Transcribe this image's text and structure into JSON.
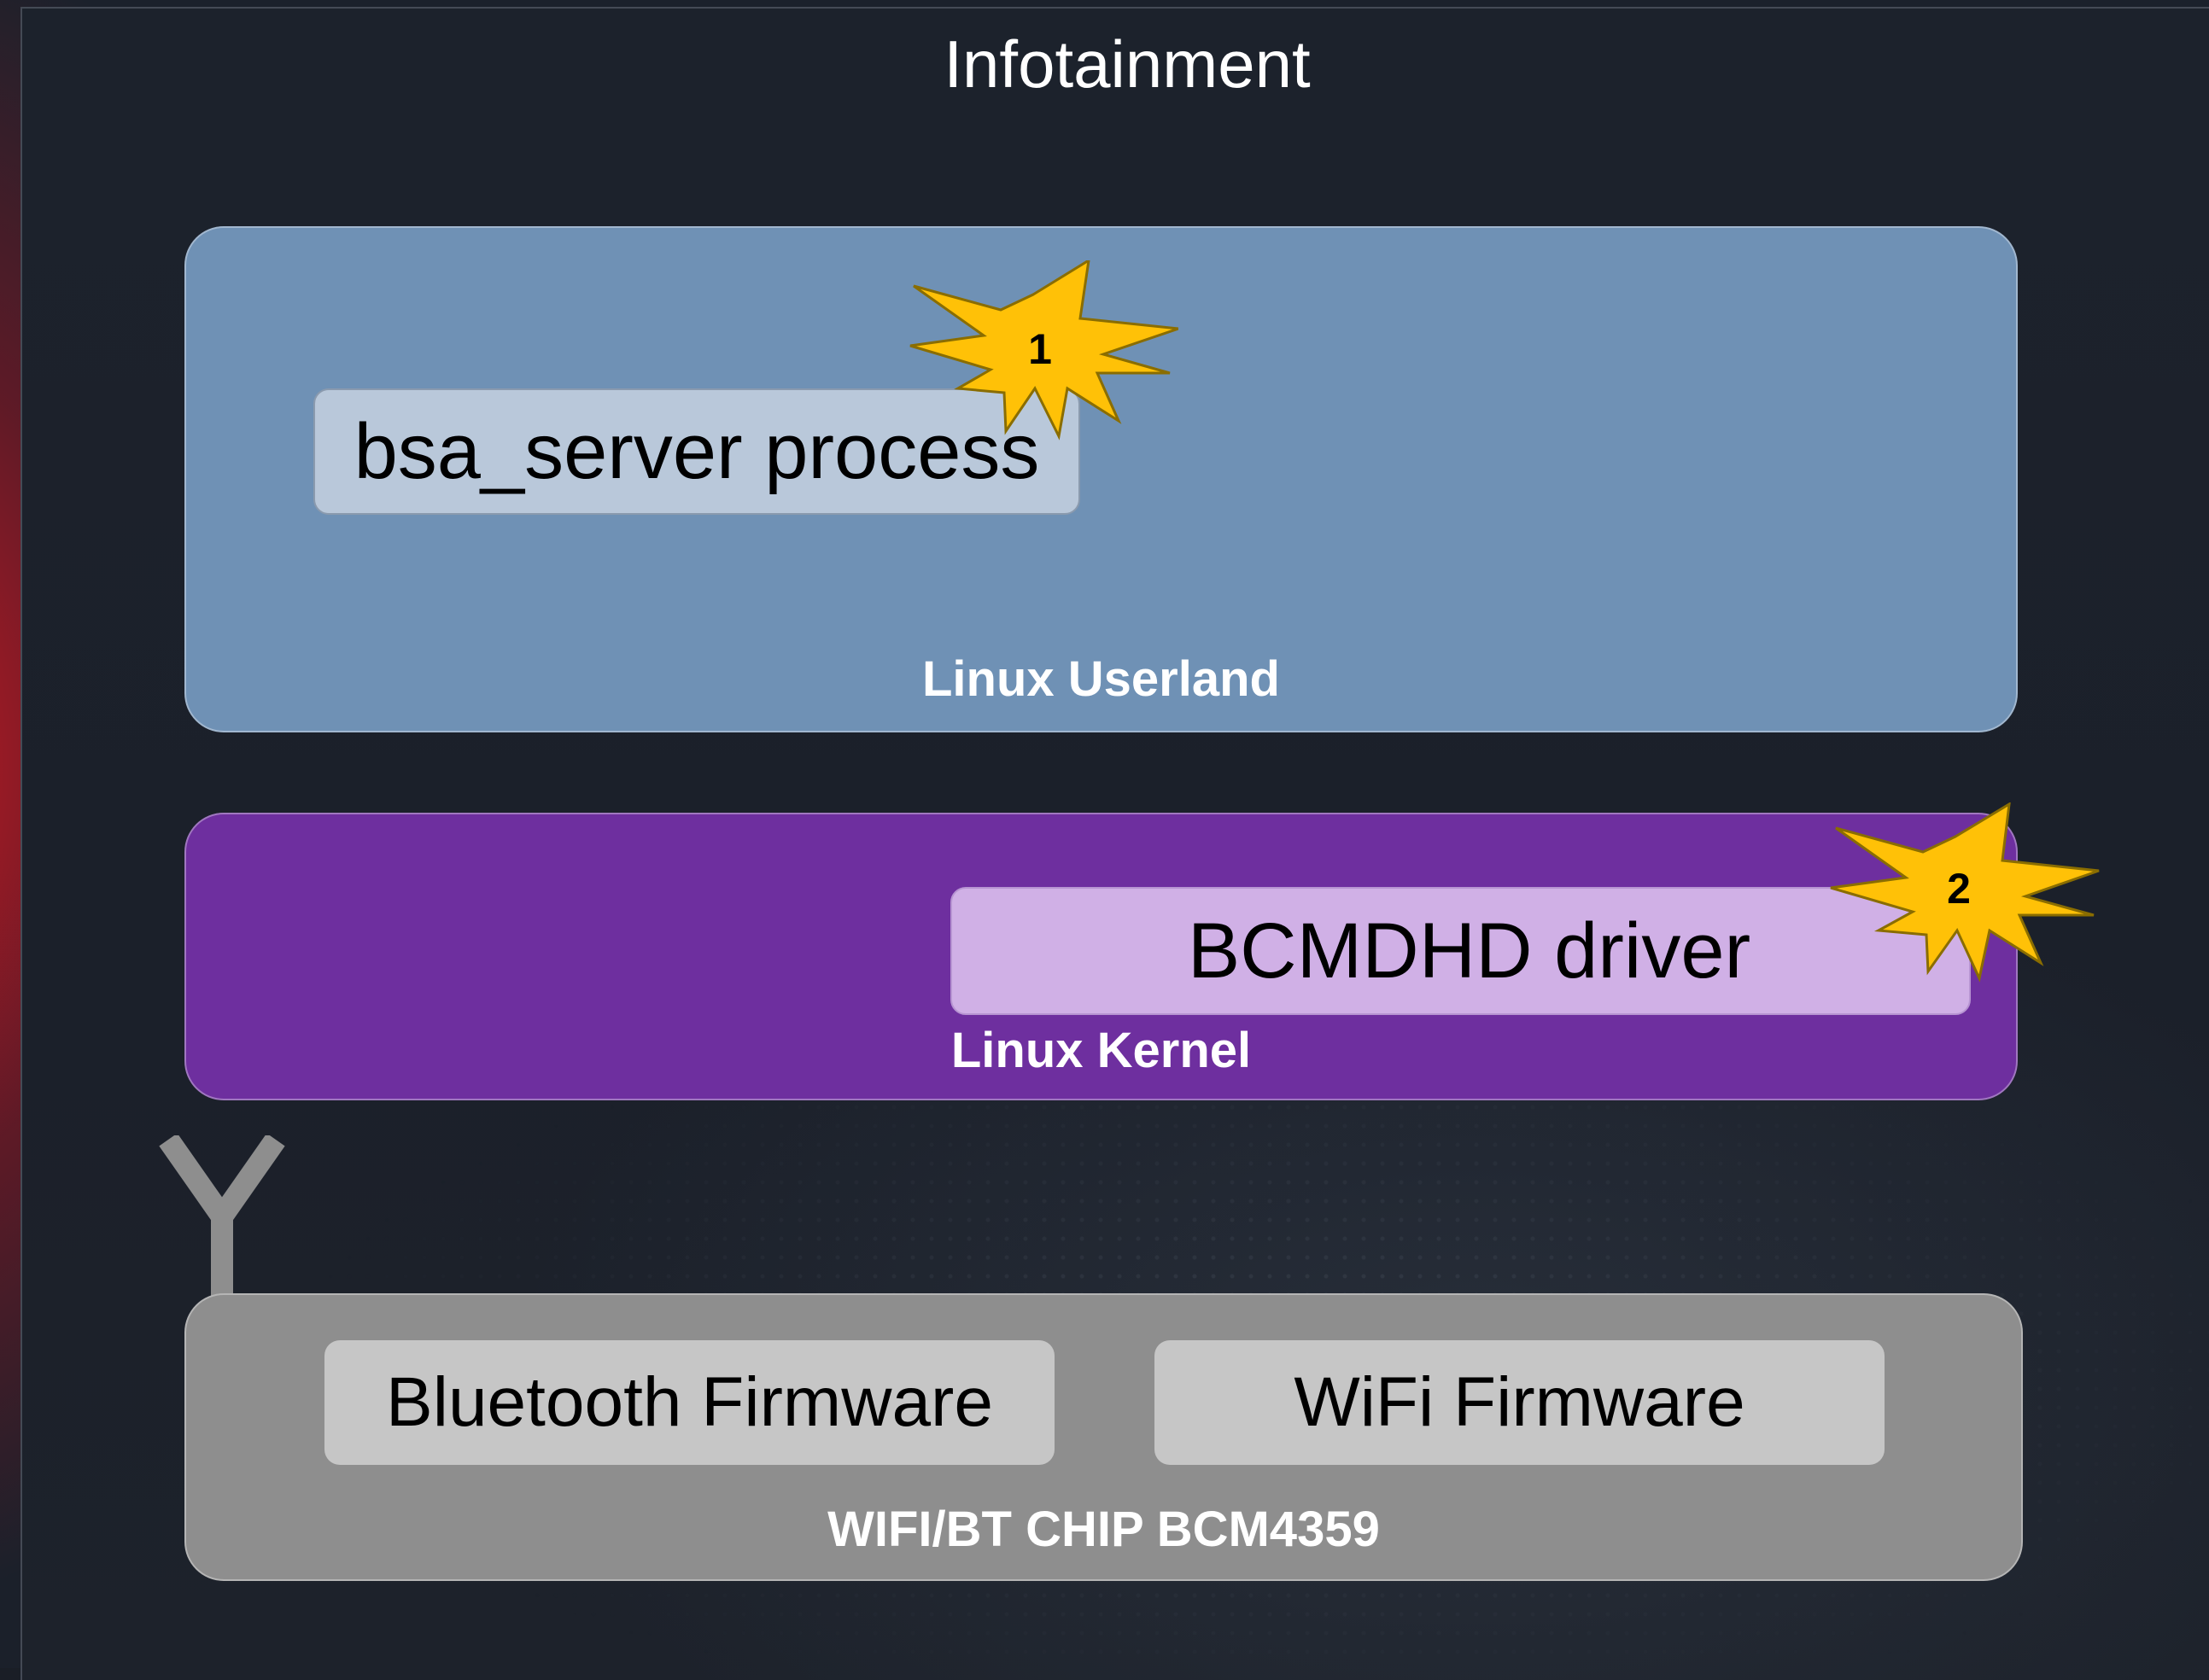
{
  "title": "Infotainment",
  "layers": {
    "userland": {
      "label": "Linux Userland",
      "process_label": "bsa_server process",
      "marker": "1"
    },
    "kernel": {
      "label": "Linux Kernel",
      "driver_label": "BCMDHD driver",
      "marker": "2"
    },
    "chip": {
      "label": "WIFI/BT CHIP BCM4359",
      "bluetooth_label": "Bluetooth Firmware",
      "wifi_label": "WiFi Firmware"
    }
  },
  "colors": {
    "background": "#1b212b",
    "userland": "#6f91b5",
    "kernel": "#6e2f9f",
    "chip": "#8e8e8e",
    "process_box": "#b9c8da",
    "driver_box": "#d0b0e6",
    "firmware_box": "#c6c6c6",
    "burst": "#ffc107",
    "accent_red": "#d21923"
  },
  "icons": {
    "marker_shape": "explosion-burst-icon",
    "antenna": "antenna-icon"
  }
}
